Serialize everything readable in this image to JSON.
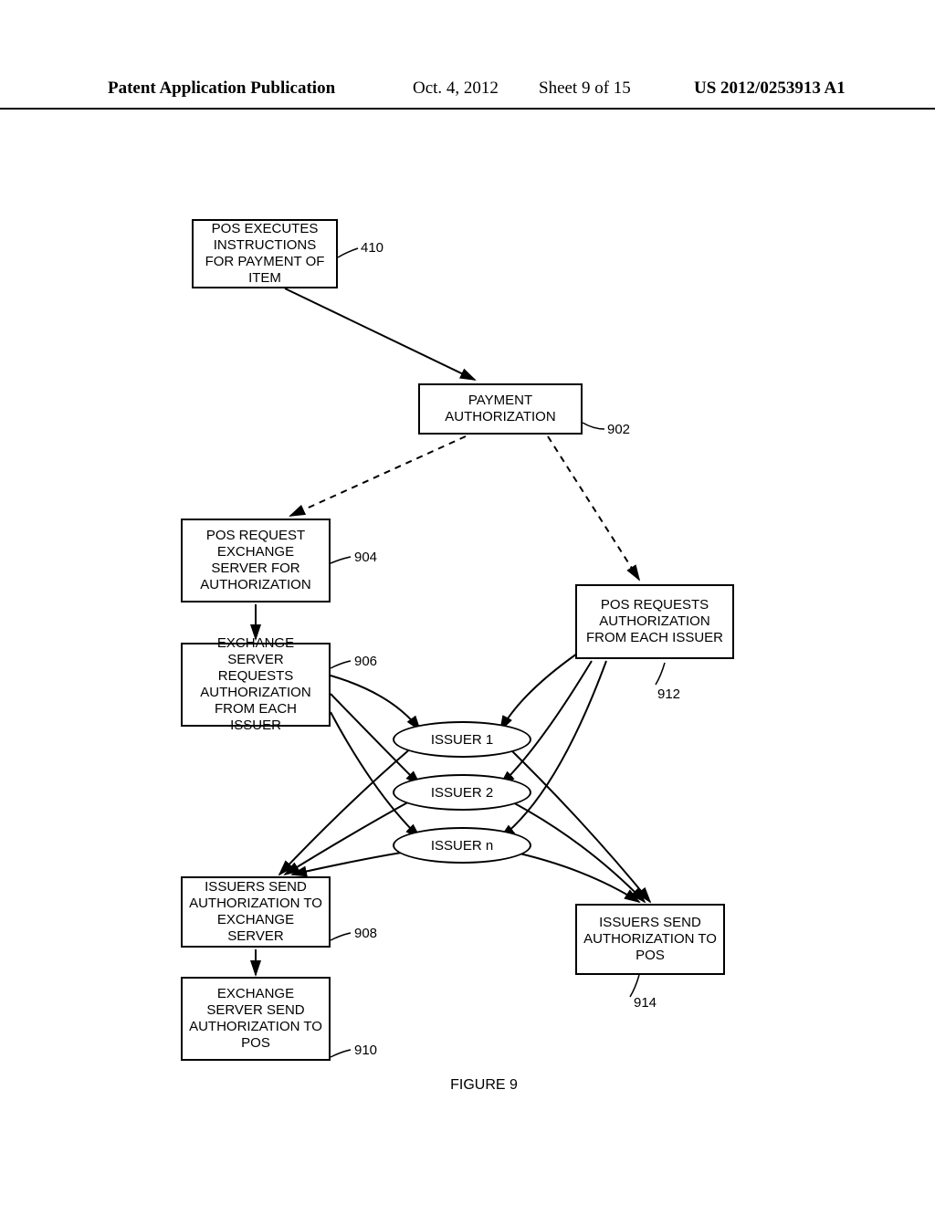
{
  "header": {
    "left": "Patent Application Publication",
    "date": "Oct. 4, 2012",
    "sheet": "Sheet 9 of 15",
    "pubno": "US 2012/0253913 A1"
  },
  "nodes": {
    "n410": "POS EXECUTES INSTRUCTIONS FOR PAYMENT OF ITEM",
    "n902": "PAYMENT AUTHORIZATION",
    "n904": "POS REQUEST EXCHANGE SERVER FOR AUTHORIZATION",
    "n906": "EXCHANGE SERVER REQUESTS AUTHORIZATION FROM EACH ISSUER",
    "n908": "ISSUERS SEND AUTHORIZATION TO EXCHANGE SERVER",
    "n910": "EXCHANGE SERVER SEND AUTHORIZATION TO POS",
    "n912": "POS REQUESTS AUTHORIZATION FROM EACH ISSUER",
    "n914": "ISSUERS SEND AUTHORIZATION TO POS",
    "issuer1": "ISSUER 1",
    "issuer2": "ISSUER 2",
    "issuern": "ISSUER n"
  },
  "refs": {
    "r410": "410",
    "r902": "902",
    "r904": "904",
    "r906": "906",
    "r908": "908",
    "r910": "910",
    "r912": "912",
    "r914": "914"
  },
  "caption": "FIGURE 9"
}
